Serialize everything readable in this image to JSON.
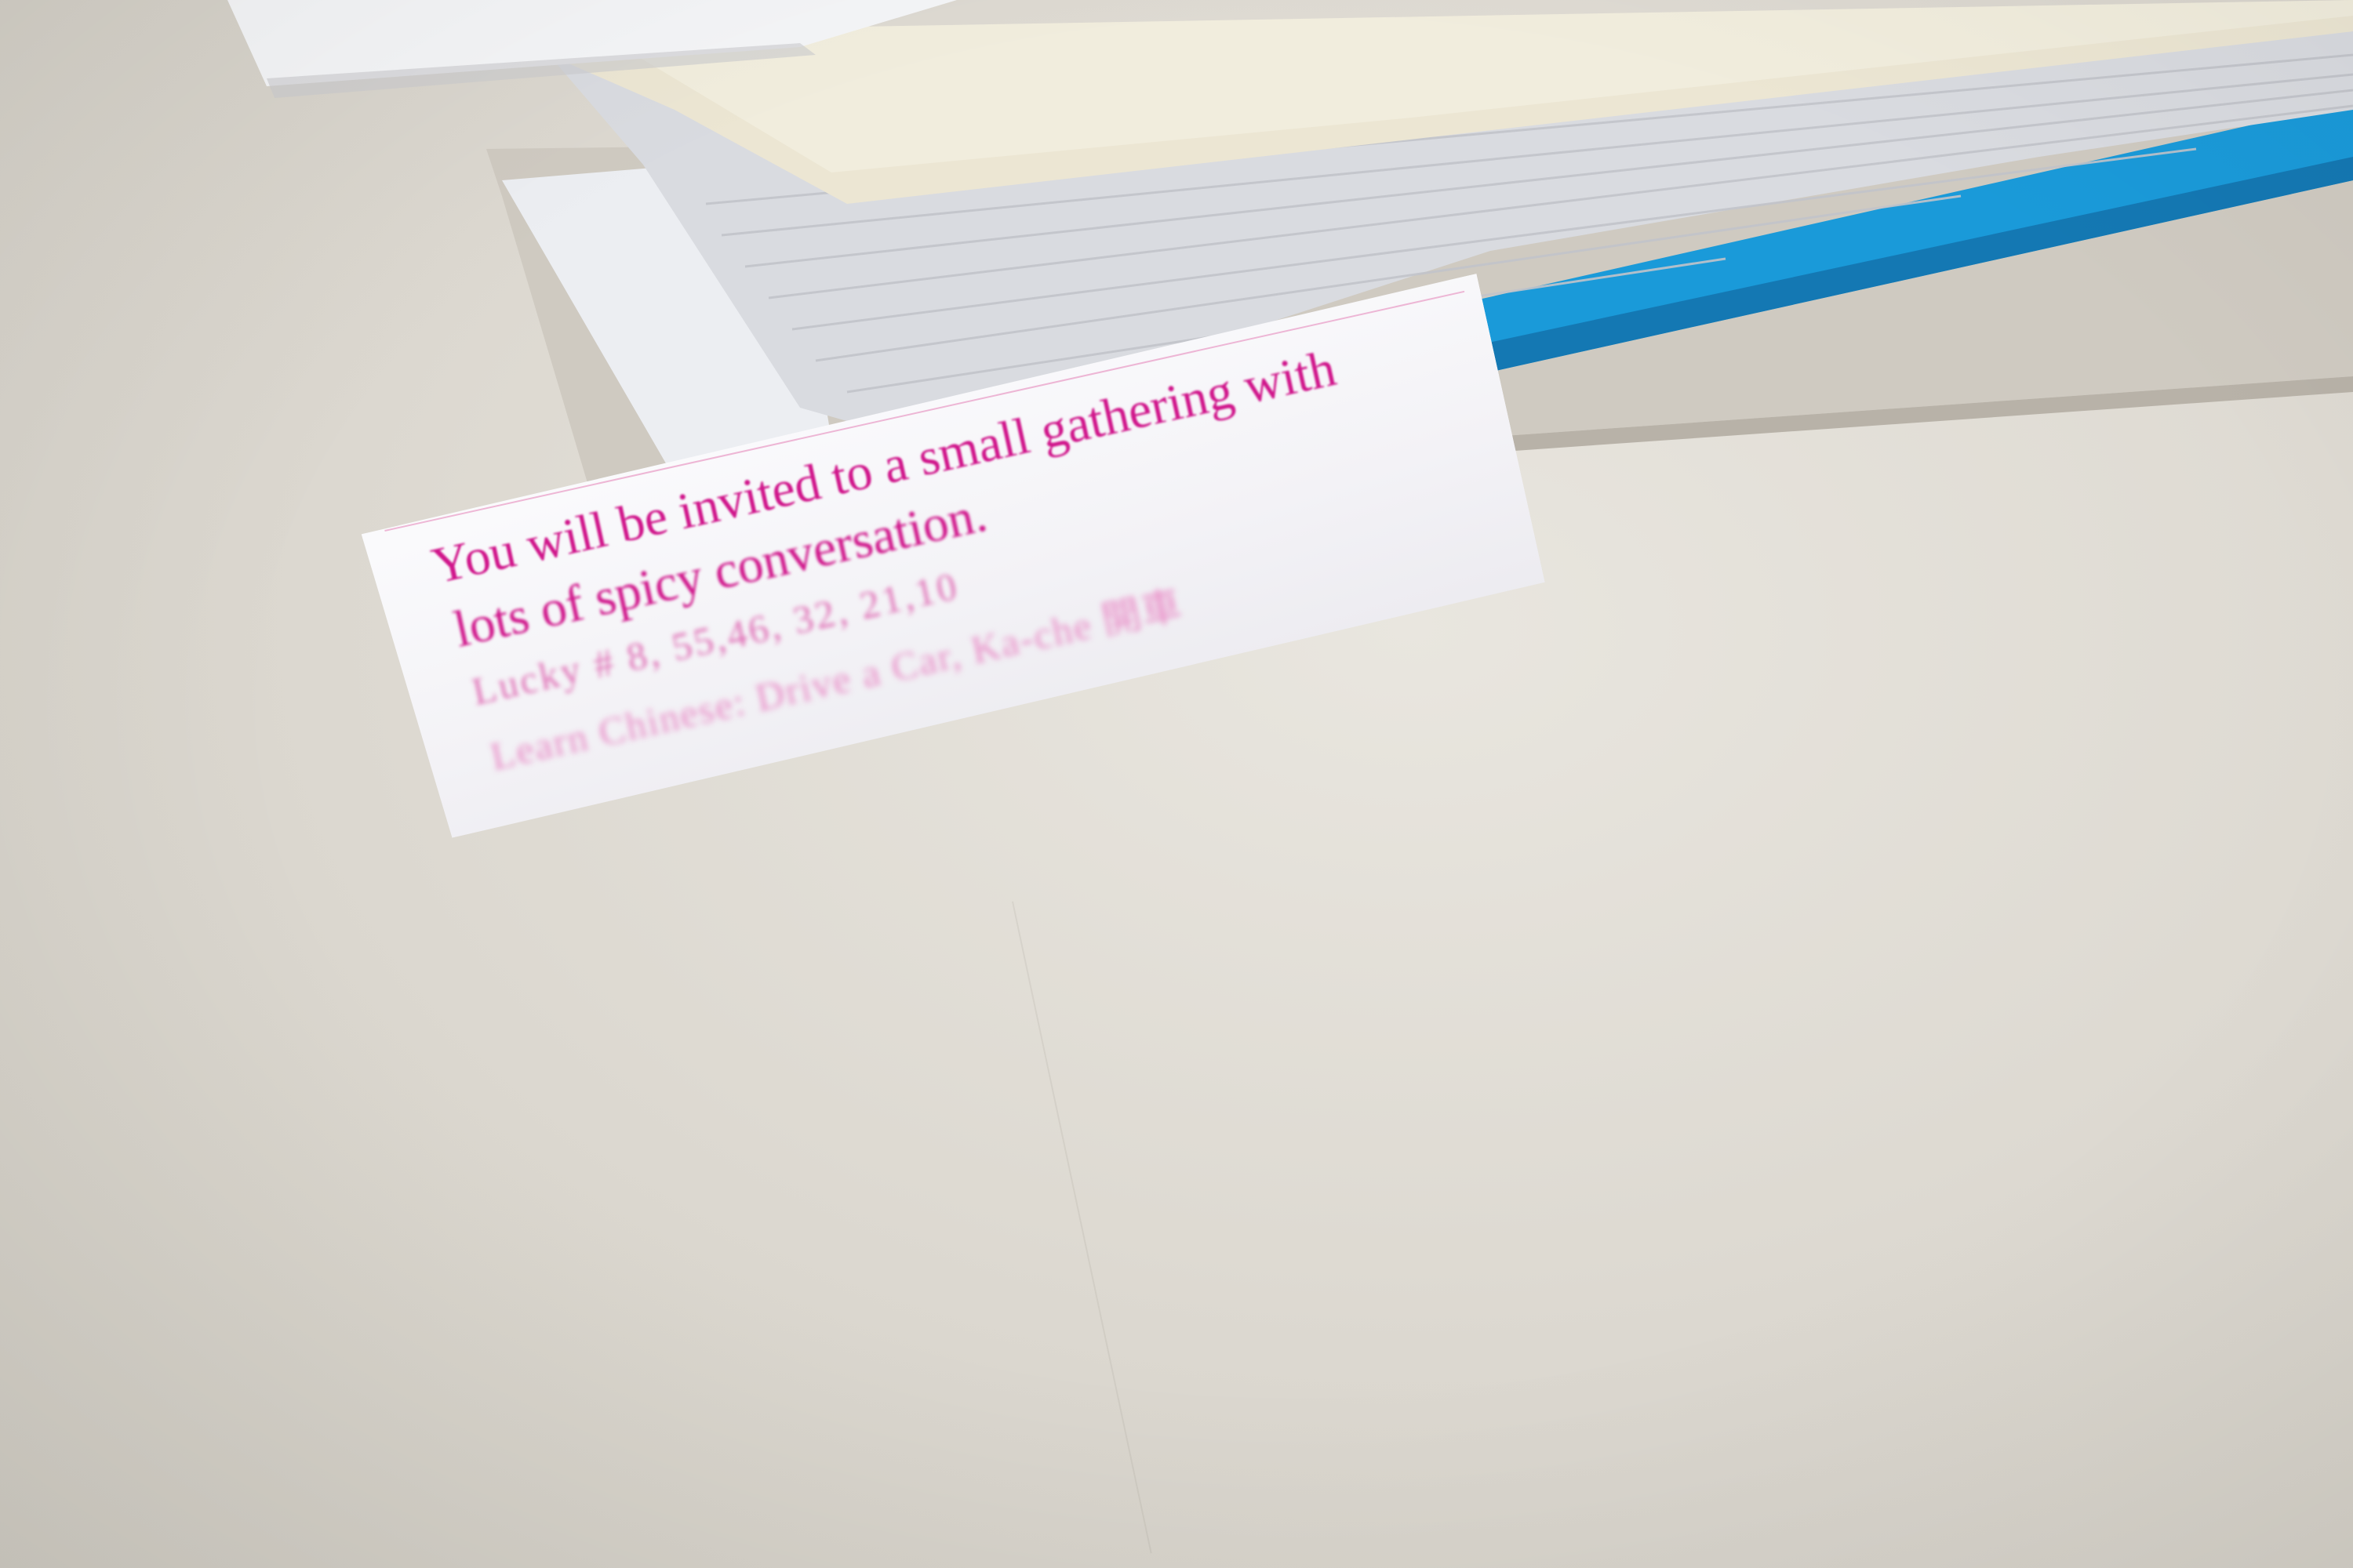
{
  "fortune": {
    "line1": "You will be invited to a small gathering with",
    "line2": "lots of spicy conversation.",
    "lucky_numbers": "Lucky # 8, 55,46, 32, 21,10",
    "learn_chinese_prefix": "Learn Chinese:",
    "learn_chinese_english": "Drive a Car,",
    "learn_chinese_pinyin": "Ka-che",
    "learn_chinese_characters": "開車"
  },
  "colors": {
    "fortune_text": "#d0168b",
    "blue_folder": "#1a9ad9",
    "desk": "#dcd8d0"
  }
}
